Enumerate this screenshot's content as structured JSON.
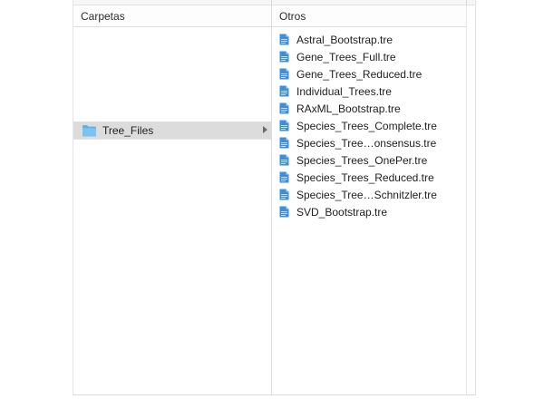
{
  "columns": {
    "folders": {
      "header": "Carpetas"
    },
    "files": {
      "header": "Otros"
    }
  },
  "folders": [
    {
      "label": "Tree_Files",
      "icon": "folder-icon",
      "selected": true,
      "has_children": true
    }
  ],
  "files": [
    {
      "label": "Astral_Bootstrap.tre",
      "icon": "document-icon"
    },
    {
      "label": "Gene_Trees_Full.tre",
      "icon": "document-icon"
    },
    {
      "label": "Gene_Trees_Reduced.tre",
      "icon": "document-icon"
    },
    {
      "label": "Individual_Trees.tre",
      "icon": "document-icon"
    },
    {
      "label": "RAxML_Bootstrap.tre",
      "icon": "document-icon"
    },
    {
      "label": "Species_Trees_Complete.tre",
      "icon": "document-icon"
    },
    {
      "label": "Species_Tree…onsensus.tre",
      "icon": "document-icon"
    },
    {
      "label": "Species_Trees_OnePer.tre",
      "icon": "document-icon"
    },
    {
      "label": "Species_Trees_Reduced.tre",
      "icon": "document-icon"
    },
    {
      "label": "Species_Tree…Schnitzler.tre",
      "icon": "document-icon"
    },
    {
      "label": "SVD_Bootstrap.tre",
      "icon": "document-icon"
    }
  ],
  "colors": {
    "selection": "#dcdcdc",
    "folder_blue": "#5db0ea",
    "document_blue": "#3d8fd9"
  }
}
